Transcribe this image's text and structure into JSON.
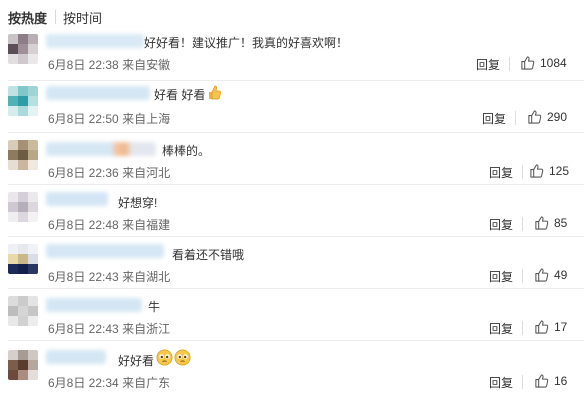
{
  "sort": {
    "hot_label": "按热度",
    "time_label": "按时间"
  },
  "comments": [
    {
      "text": "好好看！建议推广！我真的好喜欢啊！",
      "time": "6月8日 22:38",
      "location": "来自安徽",
      "reply": "回复",
      "likes": "1084"
    },
    {
      "text": "好看 好看",
      "time": "6月8日 22:50",
      "location": "来自上海",
      "reply": "回复",
      "likes": "290"
    },
    {
      "text": "棒棒的。",
      "time": "6月8日 22:36",
      "location": "来自河北",
      "reply": "回复",
      "likes": "125"
    },
    {
      "text": "好想穿!",
      "time": "6月8日 22:48",
      "location": "来自福建",
      "reply": "回复",
      "likes": "85"
    },
    {
      "text": "看着还不错哦",
      "time": "6月8日 22:43",
      "location": "来自湖北",
      "reply": "回复",
      "likes": "49"
    },
    {
      "text": "牛",
      "time": "6月8日 22:43",
      "location": "来自浙江",
      "reply": "回复",
      "likes": "17"
    },
    {
      "text": "好好看",
      "time": "6月8日 22:34",
      "location": "来自广东",
      "reply": "回复",
      "likes": "16"
    }
  ]
}
